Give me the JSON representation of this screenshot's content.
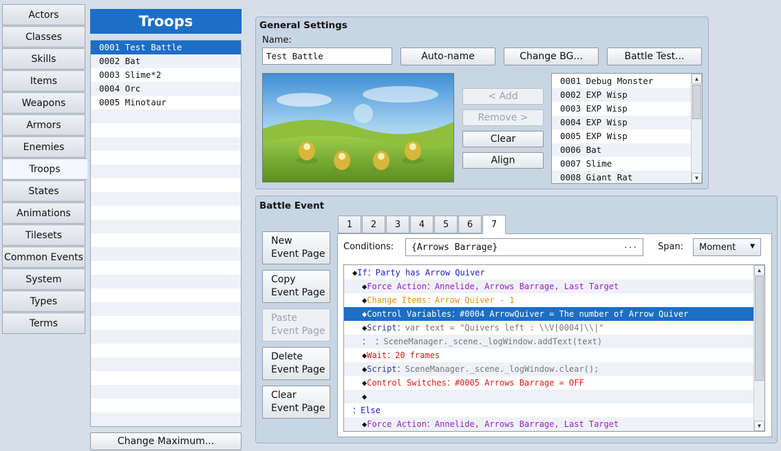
{
  "nav": [
    "Actors",
    "Classes",
    "Skills",
    "Items",
    "Weapons",
    "Armors",
    "Enemies",
    "Troops",
    "States",
    "Animations",
    "Tilesets",
    "Common Events",
    "System",
    "Types",
    "Terms"
  ],
  "active_nav": "Troops",
  "troops": {
    "header": "Troops",
    "items": [
      "0001 Test Battle",
      "0002 Bat",
      "0003 Slime*2",
      "0004 Orc",
      "0005 Minotaur"
    ],
    "change_max": "Change Maximum..."
  },
  "general": {
    "title": "General Settings",
    "name_label": "Name:",
    "name_value": "Test Battle",
    "autoname": "Auto-name",
    "change_bg": "Change BG...",
    "battle_test": "Battle Test...",
    "add": "< Add",
    "remove": "Remove >",
    "clear": "Clear",
    "align": "Align",
    "enemies": [
      "0001 Debug Monster",
      "0002 EXP Wisp",
      "0003 EXP Wisp",
      "0004 EXP Wisp",
      "0005 EXP Wisp",
      "0006 Bat",
      "0007 Slime",
      "0008 Giant Rat"
    ]
  },
  "battle_event": {
    "title": "Battle Event",
    "new_page": [
      "New",
      "Event Page"
    ],
    "copy_page": [
      "Copy",
      "Event Page"
    ],
    "paste_page": [
      "Paste",
      "Event Page"
    ],
    "delete_page": [
      "Delete",
      "Event Page"
    ],
    "clear_page": [
      "Clear",
      "Event Page"
    ],
    "tabs": [
      "1",
      "2",
      "3",
      "4",
      "5",
      "6",
      "7"
    ],
    "active_tab": "7",
    "conditions_label": "Conditions:",
    "conditions_value": "{Arrows Barrage}",
    "ellipsis": "...",
    "span_label": "Span:",
    "span_value": "Moment",
    "lines": [
      {
        "indent": 0,
        "prefix": "◆",
        "cmd": "If：Party has Arrow Quiver",
        "color": "#1a1adc"
      },
      {
        "indent": 1,
        "prefix": "◆",
        "cmd": "Force Action：Annelide, Arrows Barrage, Last Target",
        "color": "#9b1ec9"
      },
      {
        "indent": 1,
        "prefix": "◆",
        "cmd": "Change Items：Arrow Quiver - 1",
        "color": "#e8900c"
      },
      {
        "indent": 1,
        "prefix": "◆",
        "cmd": "Control Variables：#0004 ArrowQuiver = The number of Arrow Quiver",
        "color": "#d81818",
        "selected": true
      },
      {
        "indent": 1,
        "prefix": "◆",
        "cmd": "Script：",
        "rest": "var text = \"Quivers left : \\\\V[0004]\\\\|\"",
        "color": "#3040a0"
      },
      {
        "indent": 1,
        "prefix": "：",
        "cmd": "       ：",
        "rest": "SceneManager._scene._logWindow.addText(text)",
        "color": "#3040a0"
      },
      {
        "indent": 1,
        "prefix": "◆",
        "cmd": "Wait：20 frames",
        "color": "#d81818"
      },
      {
        "indent": 1,
        "prefix": "◆",
        "cmd": "Script：",
        "rest": "SceneManager._scene._logWindow.clear();",
        "color": "#3040a0"
      },
      {
        "indent": 1,
        "prefix": "◆",
        "cmd": "Control Switches：#0005 Arrows Barrage = OFF",
        "color": "#d81818"
      },
      {
        "indent": 1,
        "prefix": "◆",
        "cmd": "",
        "color": "#111"
      },
      {
        "indent": 0,
        "prefix": "：",
        "cmd": "Else",
        "color": "#1a1adc"
      },
      {
        "indent": 1,
        "prefix": "◆",
        "cmd": "Force Action：Annelide, Arrows Barrage, Last Target",
        "color": "#9b1ec9"
      }
    ]
  }
}
